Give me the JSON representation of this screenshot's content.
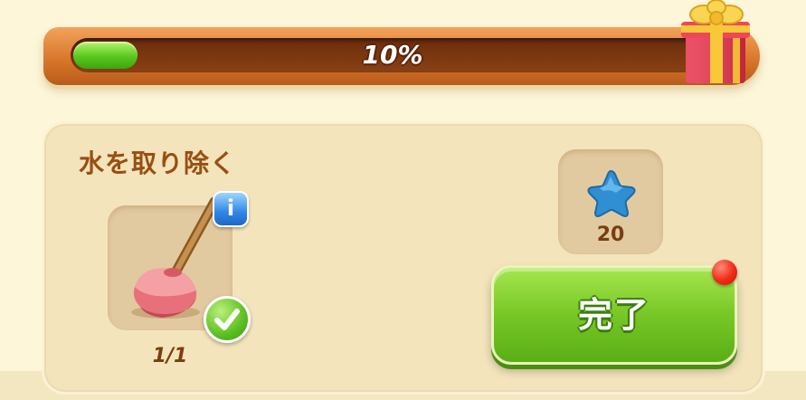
{
  "progress": {
    "value": 0.1,
    "label": "10%"
  },
  "task": {
    "title": "水を取り除く",
    "item": {
      "icon": "plunger-icon",
      "count": "1/1",
      "completed": true,
      "info_label": "i"
    },
    "reward": {
      "icon": "blue-star-icon",
      "amount": "20"
    },
    "complete_button_label": "完了",
    "has_notification": true
  },
  "colors": {
    "progress_fill": "#57c81d",
    "title": "#9a4e12",
    "button": "#77c726",
    "notification": "#f02a14"
  }
}
